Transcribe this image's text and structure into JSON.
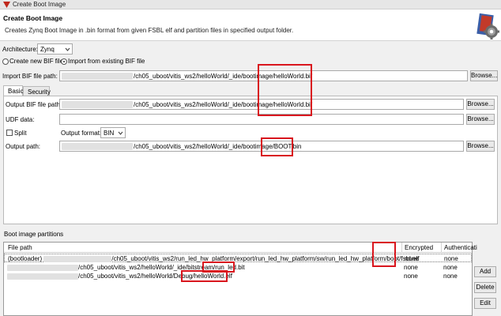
{
  "window": {
    "title": "Create Boot Image"
  },
  "banner": {
    "heading": "Create Boot Image",
    "description": "Creates Zynq Boot Image in .bin format from given FSBL elf and partition files in specified output folder."
  },
  "architecture": {
    "label": "Architecture:",
    "value": "Zynq"
  },
  "bif_mode": {
    "create_label": "Create new BIF file",
    "import_label": "Import from existing BIF file",
    "selected": "import"
  },
  "import_bif": {
    "label": "Import BIF file path:",
    "value": "/ch05_uboot/vitis_ws2/helloWorld/_ide/bootimage/helloWorld.bif",
    "browse": "Browse..."
  },
  "tabs": {
    "basic": "Basic",
    "security": "Security",
    "active": "basic"
  },
  "output_bif": {
    "label": "Output BIF file path:",
    "value": "/ch05_uboot/vitis_ws2/helloWorld/_ide/bootimage/helloWorld.bif",
    "browse": "Browse..."
  },
  "udf": {
    "label": "UDF data:",
    "value": "",
    "browse": "Browse..."
  },
  "split": {
    "label": "Split",
    "checked": false
  },
  "output_format": {
    "label": "Output format:",
    "value": "BIN"
  },
  "output_path": {
    "label": "Output path:",
    "value": "/ch05_uboot/vitis_ws2/helloWorld/_ide/bootimage/BOOT.bin",
    "browse": "Browse..."
  },
  "partitions": {
    "title": "Boot image partitions",
    "columns": [
      "File path",
      "Encrypted",
      "Authenticati"
    ],
    "rows": [
      {
        "prefix": "(bootloader) ",
        "path": "/ch05_uboot/vitis_ws2/run_led_hw_platform/export/run_led_hw_platform/sw/run_led_hw_platform/boot/fsbl.elf",
        "encrypted": "none",
        "auth": "none"
      },
      {
        "prefix": "",
        "path": "/ch05_uboot/vitis_ws2/helloWorld/_ide/bitstream/run_led.bit",
        "encrypted": "none",
        "auth": "none"
      },
      {
        "prefix": "",
        "path": "/ch05_uboot/vitis_ws2/helloWorld/Debug/helloWorld.elf",
        "encrypted": "none",
        "auth": "none"
      }
    ],
    "buttons": {
      "add": "Add",
      "delete": "Delete",
      "edit": "Edit"
    }
  },
  "colors": {
    "highlight": "#d9161e",
    "accent": "#2a5aa8"
  }
}
